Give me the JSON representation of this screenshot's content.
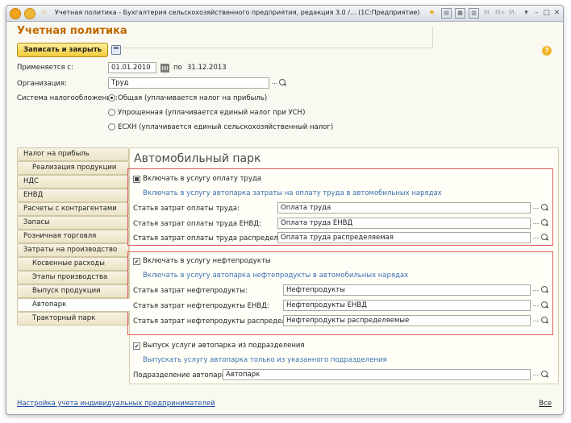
{
  "window": {
    "title": "Учетная политика - Бухгалтерия сельскохозяйственного предприятия, редакция 3.0 /... (1С:Предприятие)",
    "small_buttons": [
      "M",
      "M+",
      "M-"
    ]
  },
  "form": {
    "title": "Учетная политика",
    "save_close_label": "Записать и закрыть",
    "applies_label": "Применяется с:",
    "date_from": "01.01.2010",
    "date_to_prefix": "по",
    "date_to": "31.12.2013",
    "org_label": "Организация:",
    "org_value": "Труд",
    "tax_label": "Система налогообложения:",
    "tax_options": [
      "Общая (уплачивается налог на прибыль)",
      "Упрощенная (уплачивается единый налог при УСН)",
      "ЕСХН (уплачивается единый сельскохозяйственный налог)"
    ],
    "tax_selected_index": 0
  },
  "sidebar": {
    "items": [
      {
        "label": "Налог на прибыль",
        "sub": false
      },
      {
        "label": "Реализация продукции",
        "sub": true
      },
      {
        "label": "НДС",
        "sub": false
      },
      {
        "label": "ЕНВД",
        "sub": false
      },
      {
        "label": "Расчеты с контрагентами",
        "sub": false
      },
      {
        "label": "Запасы",
        "sub": false
      },
      {
        "label": "Розничная торговля",
        "sub": false
      },
      {
        "label": "Затраты на производство",
        "sub": false
      },
      {
        "label": "Косвенные расходы",
        "sub": true
      },
      {
        "label": "Этапы производства",
        "sub": true
      },
      {
        "label": "Выпуск продукции",
        "sub": true
      },
      {
        "label": "Автопарк",
        "sub": true
      },
      {
        "label": "Тракторный парк",
        "sub": true
      }
    ],
    "active_index": 11
  },
  "panel": {
    "title": "Автомобильный парк",
    "labor": {
      "checkbox_label": "Включать в услугу оплату труда",
      "hint": "Включать в услугу автопарка затраты на оплату труда в автомобильных нарядах",
      "rows": [
        {
          "label": "Статья затрат оплаты труда:",
          "value": "Оплата труда"
        },
        {
          "label": "Статья затрат оплаты труда ЕНВД:",
          "value": "Оплата труда ЕНВД"
        },
        {
          "label": "Статья затрат оплаты труда распределяемая:",
          "value": "Оплата труда распределяемая"
        }
      ]
    },
    "fuel": {
      "checkbox_label": "Включать в услугу нефтепродукты",
      "hint": "Включать в услугу автопарка нефтепродукты в автомобильных нарядах",
      "rows": [
        {
          "label": "Статья затрат нефтепродукты:",
          "value": "Нефтепродукты"
        },
        {
          "label": "Статья затрат нефтепродукты ЕНВД:",
          "value": "Нефтепродукты ЕНВД"
        },
        {
          "label": "Статья затрат нефтепродукты распределяемая:",
          "value": "Нефтепродукты распределяемые"
        }
      ]
    },
    "release": {
      "checkbox_label": "Выпуск услуги автопарка из подразделения",
      "hint": "Выпускать услугу автопарка только из указанного подразделения",
      "dept_label": "Подразделение автопарка:",
      "dept_value": "Автопарк"
    }
  },
  "footer": {
    "link": "Настройка учета индивидуальных предпринимателей",
    "all": "Все"
  },
  "colors": {
    "accent": "#c26a00",
    "highlight_box": "#e05a5a",
    "hint_text": "#3a6fb0",
    "link": "#1f4fa8"
  }
}
